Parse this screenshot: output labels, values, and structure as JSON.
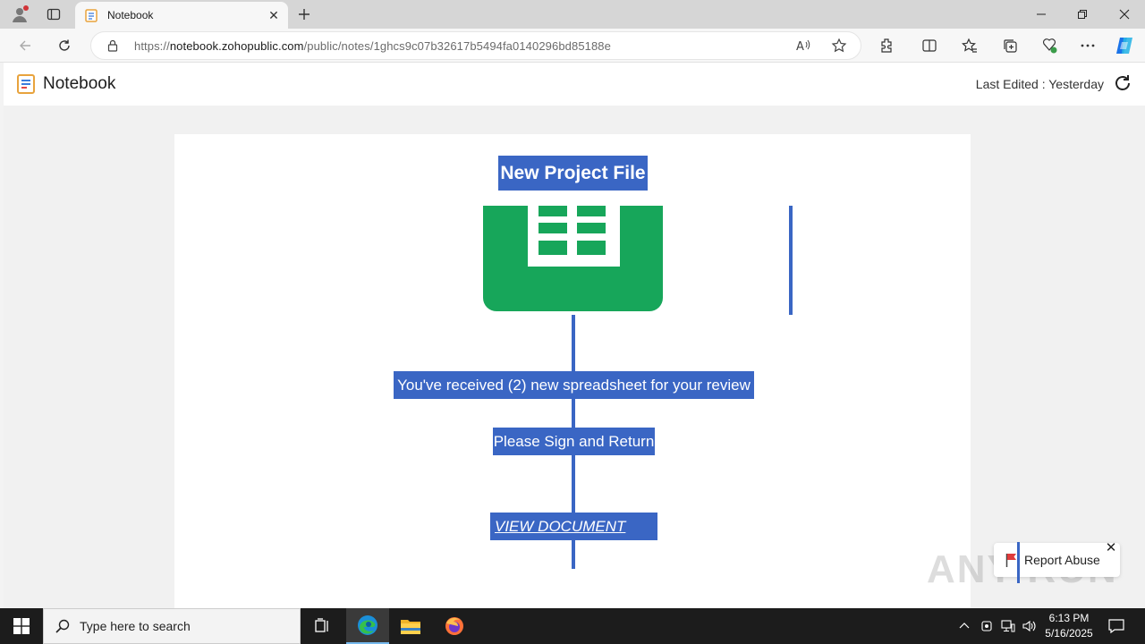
{
  "browser": {
    "tab_title": "Notebook",
    "url_prefix": "https://",
    "url_host": "notebook.zohopublic.com",
    "url_path": "/public/notes/1ghcs9c07b32617b5494fa0140296bd85188e"
  },
  "app": {
    "name": "Notebook",
    "last_edited": "Last Edited : Yesterday"
  },
  "note": {
    "title": "New Project File",
    "message": "You've received (2) new spreadsheet for your review",
    "instruction": "Please Sign and Return",
    "link_label": "VIEW DOCUMENT"
  },
  "report": {
    "label": "Report Abuse"
  },
  "watermark": "ANY RUN",
  "taskbar": {
    "search_placeholder": "Type here to search",
    "time": "6:13 PM",
    "date": "5/16/2025"
  },
  "colors": {
    "highlight": "#3a66c4",
    "sheets_green": "#17a65a"
  }
}
